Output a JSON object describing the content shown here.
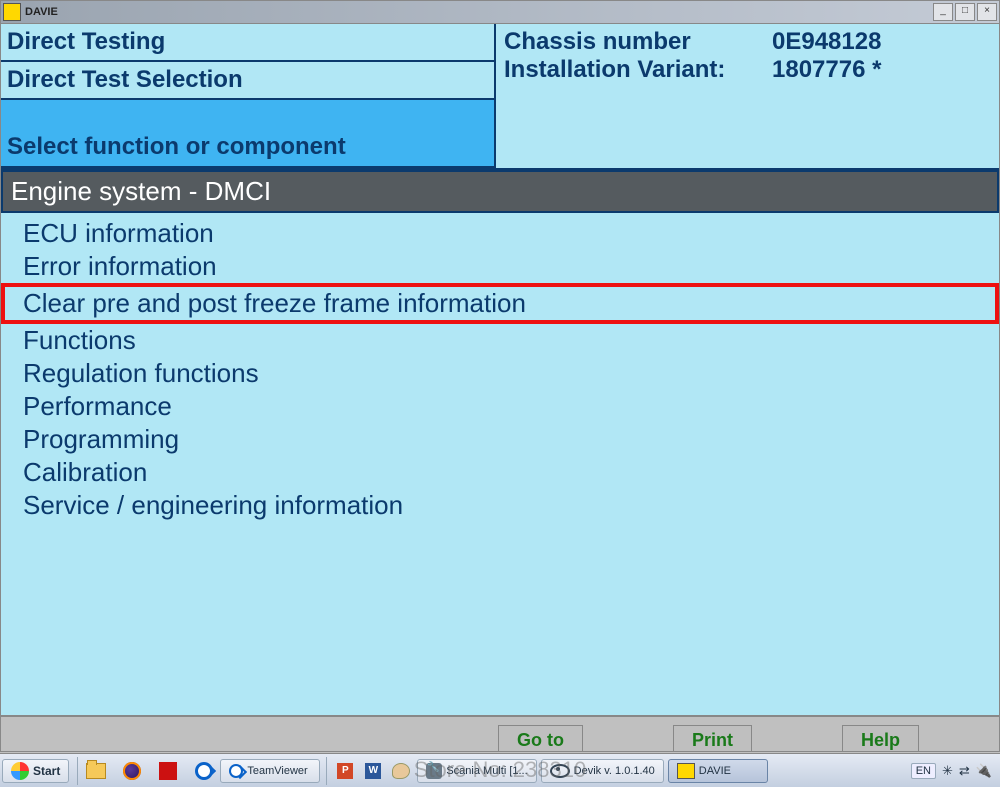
{
  "titlebar": {
    "title": "DAVIE"
  },
  "header": {
    "left": {
      "row1": "Direct Testing",
      "row2": "Direct Test Selection",
      "row3": "Select function or component"
    },
    "right": {
      "chassis_label": "Chassis number",
      "chassis_value": "0E948128",
      "variant_label": "Installation Variant:",
      "variant_value": "1807776 *"
    }
  },
  "section": {
    "title": "Engine system - DMCI"
  },
  "menu": {
    "items": [
      {
        "label": "ECU information",
        "highlighted": false
      },
      {
        "label": "Error information",
        "highlighted": false
      },
      {
        "label": "Clear pre and post freeze frame information",
        "highlighted": true
      },
      {
        "label": "Functions",
        "highlighted": false
      },
      {
        "label": "Regulation functions",
        "highlighted": false
      },
      {
        "label": "Performance",
        "highlighted": false
      },
      {
        "label": "Programming",
        "highlighted": false
      },
      {
        "label": "Calibration",
        "highlighted": false
      },
      {
        "label": "Service / engineering information",
        "highlighted": false
      }
    ]
  },
  "bottom_buttons": {
    "goto": "Go to",
    "print": "Print",
    "help": "Help"
  },
  "taskbar": {
    "start": "Start",
    "tasks": {
      "teamviewer": "TeamViewer",
      "scania": "Scania Multi  [1...",
      "devik": "Devik v. 1.0.1.40",
      "davie": "DAVIE"
    },
    "lang": "EN"
  },
  "watermark": "Store No: 238310"
}
